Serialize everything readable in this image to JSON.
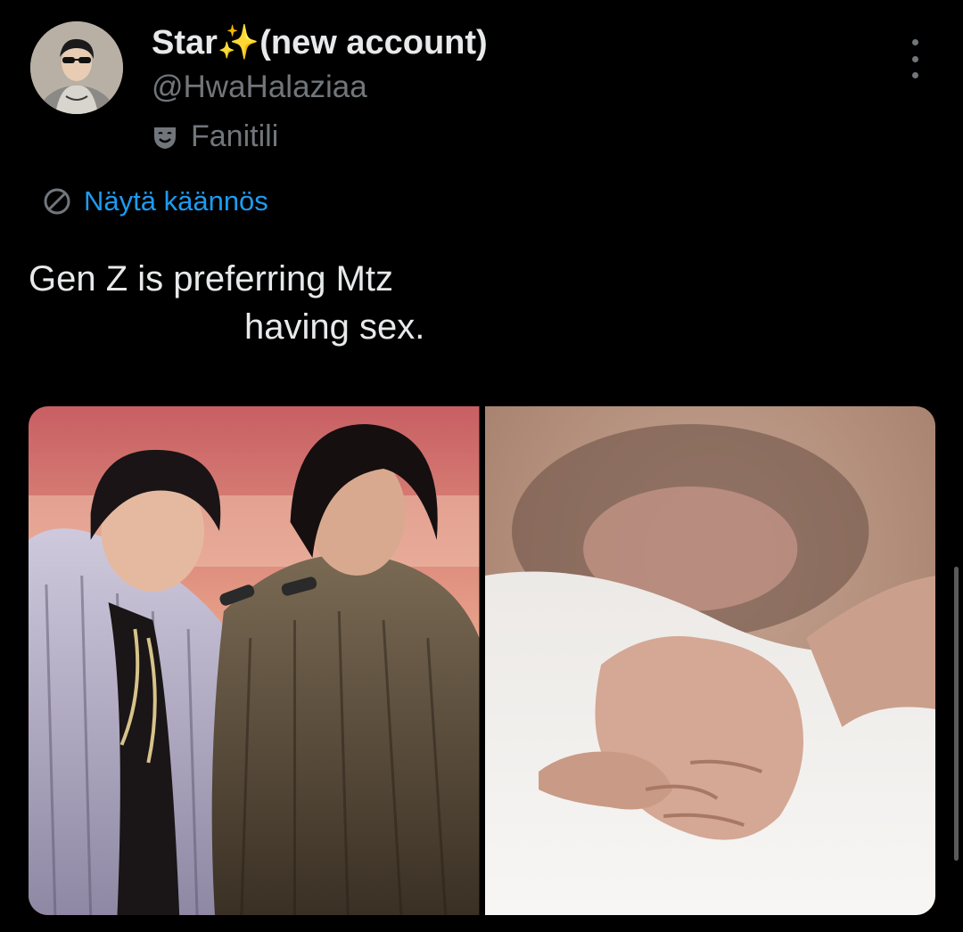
{
  "author": {
    "display_name": "Star✨(new account)",
    "handle": "@HwaHalaziaa",
    "account_label": "Fanitili",
    "avatar_icon": "profile-photo"
  },
  "translate": {
    "label": "Näytä käännös",
    "icon": "globe-icon"
  },
  "tweet": {
    "text_line1": "Gen Z is preferring Mtz",
    "text_line2": "having sex."
  },
  "media": {
    "photos": [
      {
        "description_icon": "concert-photo"
      },
      {
        "description_icon": "holding-hands-photo"
      }
    ]
  },
  "colors": {
    "background": "#000000",
    "primary_text": "#e7e9ea",
    "secondary_text": "#71767b",
    "link": "#1d9bf0"
  }
}
